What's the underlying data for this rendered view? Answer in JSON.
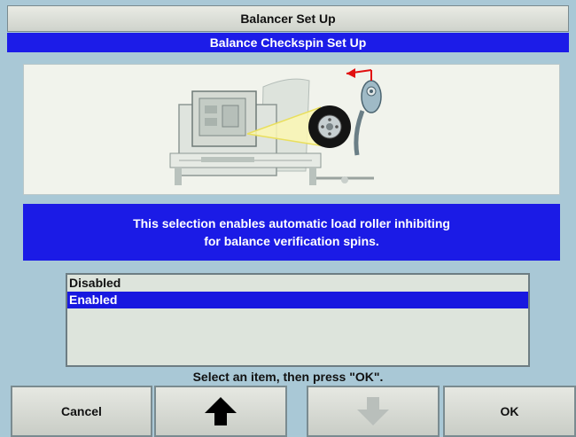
{
  "window": {
    "title": "Balancer Set Up",
    "subtitle": "Balance Checkspin Set Up"
  },
  "illustration": {
    "icon": "balancer-machine-illustration"
  },
  "info": {
    "line1": "This selection enables automatic load roller inhibiting",
    "line2": "for balance verification spins."
  },
  "list": {
    "items": [
      {
        "label": "Disabled",
        "selected": false
      },
      {
        "label": "Enabled",
        "selected": true
      }
    ]
  },
  "prompt": "Select an item, then press \"OK\".",
  "softkeys": {
    "cancel_label": "Cancel",
    "up_icon": "up-arrow-icon",
    "down_icon": "down-arrow-icon",
    "down_enabled": false,
    "ok_label": "OK"
  },
  "colors": {
    "highlight_blue": "#1c1ce8",
    "screen_background": "#a9c8d6"
  }
}
